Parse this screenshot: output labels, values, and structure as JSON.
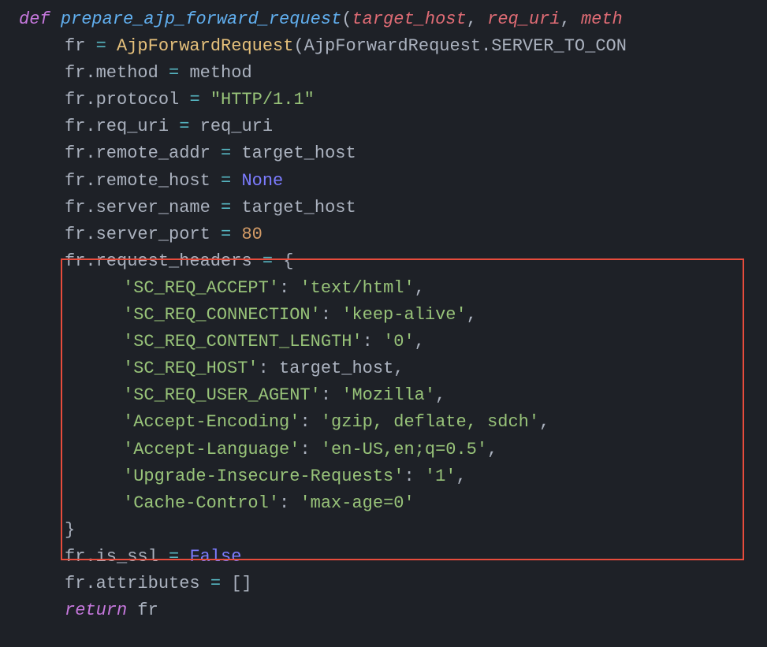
{
  "code": {
    "keyword_def": "def",
    "function_name": "prepare_ajp_forward_request",
    "params": {
      "p1": "target_host",
      "p2": "req_uri",
      "p3": "meth"
    },
    "line2": {
      "var": "fr",
      "op": "=",
      "cls": "AjpForwardRequest",
      "arg_cls": "AjpForwardRequest",
      "arg_attr": "SERVER_TO_CON"
    },
    "line3": {
      "obj": "fr",
      "attr": "method",
      "op": "=",
      "rhs": "method"
    },
    "line4": {
      "obj": "fr",
      "attr": "protocol",
      "op": "=",
      "rhs": "\"HTTP/1.1\""
    },
    "line5": {
      "obj": "fr",
      "attr": "req_uri",
      "op": "=",
      "rhs": "req_uri"
    },
    "line6": {
      "obj": "fr",
      "attr": "remote_addr",
      "op": "=",
      "rhs": "target_host"
    },
    "line7": {
      "obj": "fr",
      "attr": "remote_host",
      "op": "=",
      "rhs": "None"
    },
    "line8": {
      "obj": "fr",
      "attr": "server_name",
      "op": "=",
      "rhs": "target_host"
    },
    "line9": {
      "obj": "fr",
      "attr": "server_port",
      "op": "=",
      "rhs": "80"
    },
    "line10": {
      "obj": "fr",
      "attr": "request_headers",
      "op": "=",
      "brace": "{"
    },
    "headers": {
      "h1": {
        "k": "'SC_REQ_ACCEPT'",
        "v": "'text/html'"
      },
      "h2": {
        "k": "'SC_REQ_CONNECTION'",
        "v": "'keep-alive'"
      },
      "h3": {
        "k": "'SC_REQ_CONTENT_LENGTH'",
        "v": "'0'"
      },
      "h4": {
        "k": "'SC_REQ_HOST'",
        "v_plain": "target_host"
      },
      "h5": {
        "k": "'SC_REQ_USER_AGENT'",
        "v": "'Mozilla'"
      },
      "h6": {
        "k": "'Accept-Encoding'",
        "v": "'gzip, deflate, sdch'"
      },
      "h7": {
        "k": "'Accept-Language'",
        "v": "'en-US,en;q=0.5'"
      },
      "h8": {
        "k": "'Upgrade-Insecure-Requests'",
        "v": "'1'"
      },
      "h9": {
        "k": "'Cache-Control'",
        "v": "'max-age=0'"
      }
    },
    "close_brace": "}",
    "line_ssl": {
      "obj": "fr",
      "attr": "is_ssl",
      "op": "=",
      "rhs": "False"
    },
    "line_attrs": {
      "obj": "fr",
      "attr": "attributes",
      "op": "=",
      "rhs": "[]"
    },
    "line_return": {
      "kw": "return",
      "var": "fr"
    }
  }
}
